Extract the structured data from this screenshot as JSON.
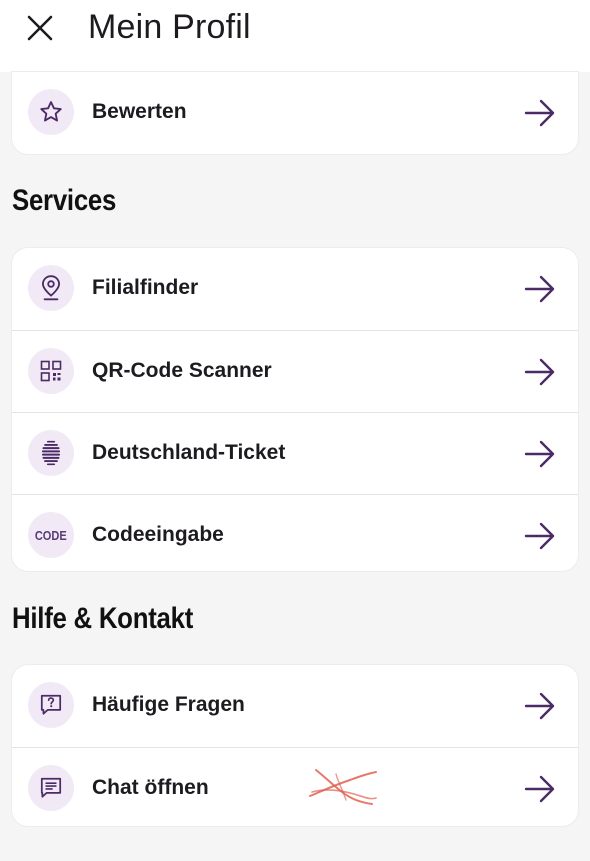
{
  "header": {
    "title": "Mein Profil"
  },
  "top_card": {
    "items": [
      {
        "label": "Bewerten",
        "icon": "star-icon"
      }
    ]
  },
  "services": {
    "title": "Services",
    "items": [
      {
        "label": "Filialfinder",
        "icon": "location-pin-icon"
      },
      {
        "label": "QR-Code Scanner",
        "icon": "qr-code-icon"
      },
      {
        "label": "Deutschland-Ticket",
        "icon": "ticket-icon"
      },
      {
        "label": "Codeeingabe",
        "icon": "code-icon",
        "icon_text": "CODE"
      }
    ]
  },
  "help": {
    "title": "Hilfe & Kontakt",
    "items": [
      {
        "label": "Häufige Fragen",
        "icon": "faq-icon"
      },
      {
        "label": "Chat öffnen",
        "icon": "chat-icon"
      }
    ]
  },
  "colors": {
    "accent": "#4b2a66",
    "icon_bg": "#f1eaf6",
    "background": "#f5f5f5",
    "card": "#ffffff"
  }
}
